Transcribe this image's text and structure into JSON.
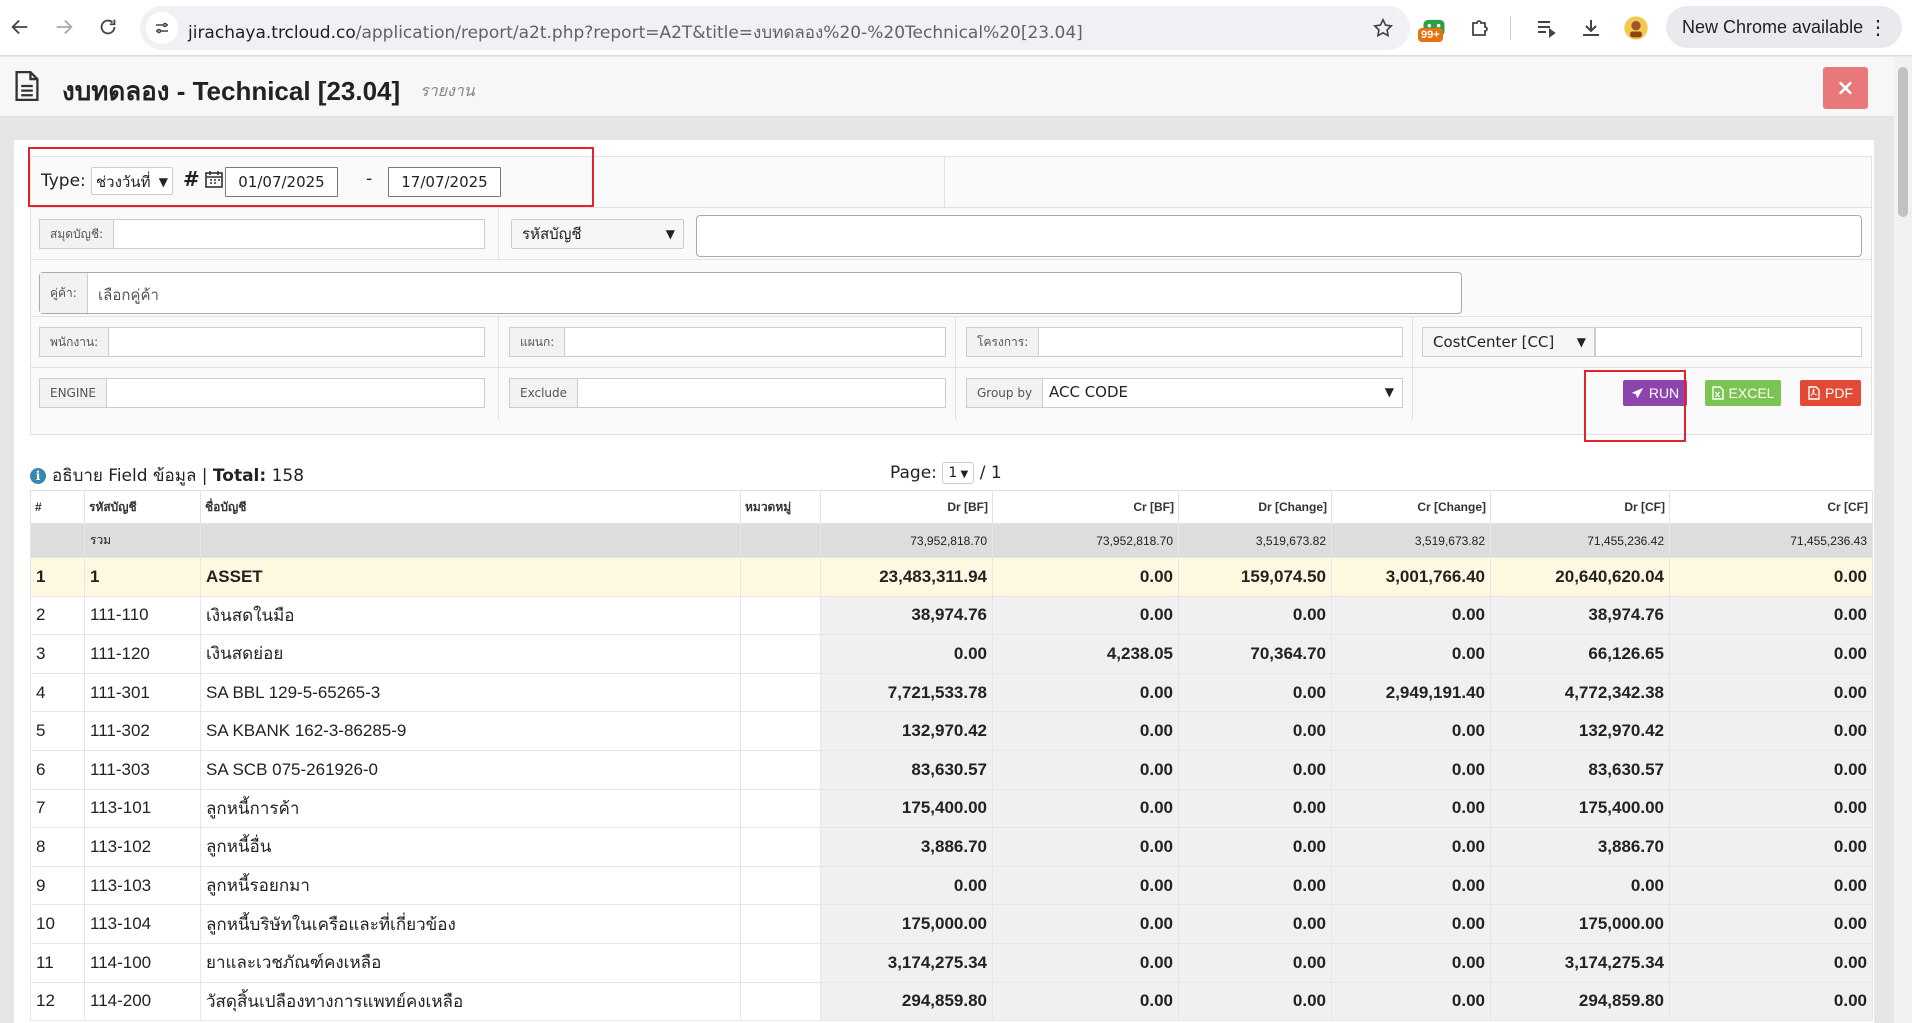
{
  "browser": {
    "url_host": "jirachaya.trcloud.co",
    "url_path": "/application/report/a2t.php?report=A2T&title=งบทดลอง%20-%20Technical%20[23.04]",
    "extension_badge": "99+",
    "update_label": "New Chrome available"
  },
  "header": {
    "title": "งบทดลอง - Technical [23.04]",
    "subtitle": "รายงาน",
    "close_icon": "×"
  },
  "filter": {
    "type_label": "Type:",
    "type_value": "ช่วงวันที่",
    "date_from": "01/07/2025",
    "date_sep": "-",
    "date_to": "17/07/2025",
    "book_label": "สมุดบัญชี:",
    "account_select": "รหัสบัญชี",
    "partner_label": "คู่ค้า:",
    "partner_placeholder": "เลือกคู่ค้า",
    "employee_label": "พนักงาน:",
    "department_label": "แผนก:",
    "project_label": "โครงการ:",
    "costcenter_select": "CostCenter [CC]",
    "engine_label": "ENGINE",
    "exclude_label": "Exclude",
    "groupby_label": "Group by",
    "groupby_value": "ACC CODE",
    "run_label": "RUN",
    "excel_label": "EXCEL",
    "pdf_label": "PDF"
  },
  "summary": {
    "info_text": "อธิบาย Field ข้อมูล | ",
    "total_label": "Total:",
    "total_value": "158",
    "page_label": "Page:",
    "page_value": "1",
    "page_total": "/ 1"
  },
  "table": {
    "headers": [
      "#",
      "รหัสบัญชี",
      "ชื่อบัญชี",
      "หมวดหมู่",
      "Dr [BF]",
      "Cr [BF]",
      "Dr [Change]",
      "Cr [Change]",
      "Dr [CF]",
      "Cr [CF]"
    ],
    "total_row": [
      "",
      "รวม",
      "",
      "",
      "73,952,818.70",
      "73,952,818.70",
      "3,519,673.82",
      "3,519,673.82",
      "71,455,236.42",
      "71,455,236.43"
    ],
    "rows": [
      [
        "1",
        "1",
        "ASSET",
        "",
        "23,483,311.94",
        "0.00",
        "159,074.50",
        "3,001,766.40",
        "20,640,620.04",
        "0.00"
      ],
      [
        "2",
        "111-110",
        "เงินสดในมือ",
        "",
        "38,974.76",
        "0.00",
        "0.00",
        "0.00",
        "38,974.76",
        "0.00"
      ],
      [
        "3",
        "111-120",
        "เงินสดย่อย",
        "",
        "0.00",
        "4,238.05",
        "70,364.70",
        "0.00",
        "66,126.65",
        "0.00"
      ],
      [
        "4",
        "111-301",
        "SA BBL 129-5-65265-3",
        "",
        "7,721,533.78",
        "0.00",
        "0.00",
        "2,949,191.40",
        "4,772,342.38",
        "0.00"
      ],
      [
        "5",
        "111-302",
        "SA KBANK 162-3-86285-9",
        "",
        "132,970.42",
        "0.00",
        "0.00",
        "0.00",
        "132,970.42",
        "0.00"
      ],
      [
        "6",
        "111-303",
        "SA SCB 075-261926-0",
        "",
        "83,630.57",
        "0.00",
        "0.00",
        "0.00",
        "83,630.57",
        "0.00"
      ],
      [
        "7",
        "113-101",
        "ลูกหนี้การค้า",
        "",
        "175,400.00",
        "0.00",
        "0.00",
        "0.00",
        "175,400.00",
        "0.00"
      ],
      [
        "8",
        "113-102",
        "ลูกหนี้อื่น",
        "",
        "3,886.70",
        "0.00",
        "0.00",
        "0.00",
        "3,886.70",
        "0.00"
      ],
      [
        "9",
        "113-103",
        "ลูกหนี้รอยกมา",
        "",
        "0.00",
        "0.00",
        "0.00",
        "0.00",
        "0.00",
        "0.00"
      ],
      [
        "10",
        "113-104",
        "ลูกหนี้บริษัทในเครือและที่เกี่ยวข้อง",
        "",
        "175,000.00",
        "0.00",
        "0.00",
        "0.00",
        "175,000.00",
        "0.00"
      ],
      [
        "11",
        "114-100",
        "ยาและเวชภัณฑ์คงเหลือ",
        "",
        "3,174,275.34",
        "0.00",
        "0.00",
        "0.00",
        "3,174,275.34",
        "0.00"
      ],
      [
        "12",
        "114-200",
        "วัสดุสิ้นเปลืองทางการแพทย์คงเหลือ",
        "",
        "294,859.80",
        "0.00",
        "0.00",
        "0.00",
        "294,859.80",
        "0.00"
      ]
    ]
  }
}
